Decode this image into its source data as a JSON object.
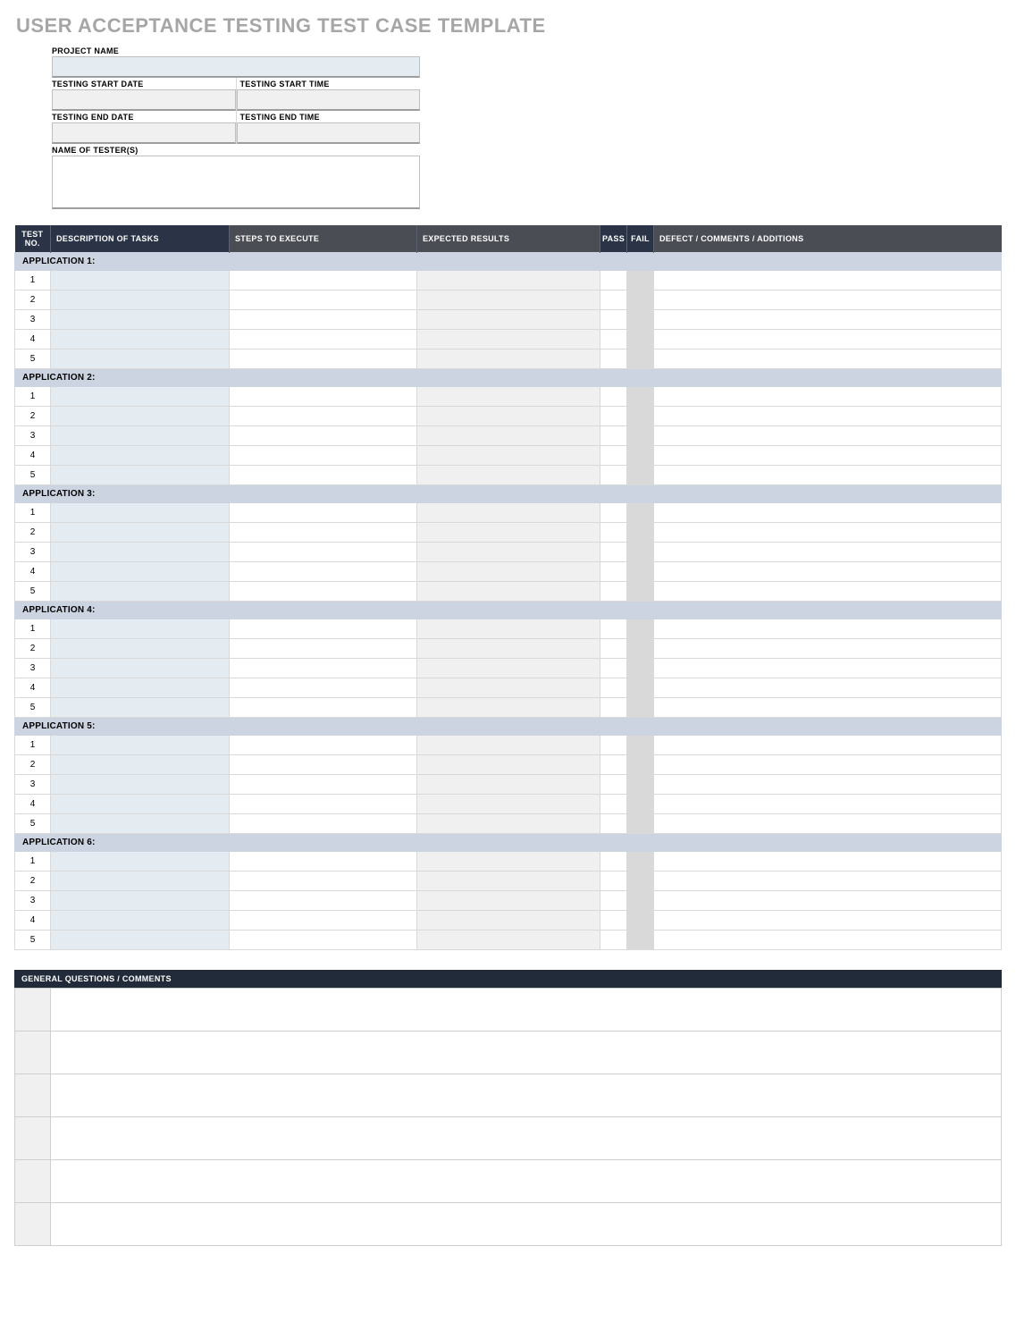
{
  "title": "USER ACCEPTANCE TESTING TEST CASE TEMPLATE",
  "meta": {
    "project_name_label": "PROJECT NAME",
    "project_name_value": "",
    "start_date_label": "TESTING START DATE",
    "start_date_value": "",
    "start_time_label": "TESTING START TIME",
    "start_time_value": "",
    "end_date_label": "TESTING END DATE",
    "end_date_value": "",
    "end_time_label": "TESTING END TIME",
    "end_time_value": "",
    "testers_label": "NAME OF TESTER(S)",
    "testers_value": ""
  },
  "columns": {
    "test_no": "TEST NO.",
    "description": "DESCRIPTION OF TASKS",
    "steps": "STEPS TO EXECUTE",
    "expected": "EXPECTED RESULTS",
    "pass": "PASS",
    "fail": "FAIL",
    "defect": "DEFECT / COMMENTS / ADDITIONS"
  },
  "apps": [
    {
      "heading": "APPLICATION 1:",
      "rows": [
        {
          "no": "1",
          "desc": "",
          "steps": "",
          "expected": "",
          "pass": "",
          "fail": "",
          "defect": ""
        },
        {
          "no": "2",
          "desc": "",
          "steps": "",
          "expected": "",
          "pass": "",
          "fail": "",
          "defect": ""
        },
        {
          "no": "3",
          "desc": "",
          "steps": "",
          "expected": "",
          "pass": "",
          "fail": "",
          "defect": ""
        },
        {
          "no": "4",
          "desc": "",
          "steps": "",
          "expected": "",
          "pass": "",
          "fail": "",
          "defect": ""
        },
        {
          "no": "5",
          "desc": "",
          "steps": "",
          "expected": "",
          "pass": "",
          "fail": "",
          "defect": ""
        }
      ]
    },
    {
      "heading": "APPLICATION 2:",
      "rows": [
        {
          "no": "1",
          "desc": "",
          "steps": "",
          "expected": "",
          "pass": "",
          "fail": "",
          "defect": ""
        },
        {
          "no": "2",
          "desc": "",
          "steps": "",
          "expected": "",
          "pass": "",
          "fail": "",
          "defect": ""
        },
        {
          "no": "3",
          "desc": "",
          "steps": "",
          "expected": "",
          "pass": "",
          "fail": "",
          "defect": ""
        },
        {
          "no": "4",
          "desc": "",
          "steps": "",
          "expected": "",
          "pass": "",
          "fail": "",
          "defect": ""
        },
        {
          "no": "5",
          "desc": "",
          "steps": "",
          "expected": "",
          "pass": "",
          "fail": "",
          "defect": ""
        }
      ]
    },
    {
      "heading": "APPLICATION 3:",
      "rows": [
        {
          "no": "1",
          "desc": "",
          "steps": "",
          "expected": "",
          "pass": "",
          "fail": "",
          "defect": ""
        },
        {
          "no": "2",
          "desc": "",
          "steps": "",
          "expected": "",
          "pass": "",
          "fail": "",
          "defect": ""
        },
        {
          "no": "3",
          "desc": "",
          "steps": "",
          "expected": "",
          "pass": "",
          "fail": "",
          "defect": ""
        },
        {
          "no": "4",
          "desc": "",
          "steps": "",
          "expected": "",
          "pass": "",
          "fail": "",
          "defect": ""
        },
        {
          "no": "5",
          "desc": "",
          "steps": "",
          "expected": "",
          "pass": "",
          "fail": "",
          "defect": ""
        }
      ]
    },
    {
      "heading": "APPLICATION 4:",
      "rows": [
        {
          "no": "1",
          "desc": "",
          "steps": "",
          "expected": "",
          "pass": "",
          "fail": "",
          "defect": ""
        },
        {
          "no": "2",
          "desc": "",
          "steps": "",
          "expected": "",
          "pass": "",
          "fail": "",
          "defect": ""
        },
        {
          "no": "3",
          "desc": "",
          "steps": "",
          "expected": "",
          "pass": "",
          "fail": "",
          "defect": ""
        },
        {
          "no": "4",
          "desc": "",
          "steps": "",
          "expected": "",
          "pass": "",
          "fail": "",
          "defect": ""
        },
        {
          "no": "5",
          "desc": "",
          "steps": "",
          "expected": "",
          "pass": "",
          "fail": "",
          "defect": ""
        }
      ]
    },
    {
      "heading": "APPLICATION 5:",
      "rows": [
        {
          "no": "1",
          "desc": "",
          "steps": "",
          "expected": "",
          "pass": "",
          "fail": "",
          "defect": ""
        },
        {
          "no": "2",
          "desc": "",
          "steps": "",
          "expected": "",
          "pass": "",
          "fail": "",
          "defect": ""
        },
        {
          "no": "3",
          "desc": "",
          "steps": "",
          "expected": "",
          "pass": "",
          "fail": "",
          "defect": ""
        },
        {
          "no": "4",
          "desc": "",
          "steps": "",
          "expected": "",
          "pass": "",
          "fail": "",
          "defect": ""
        },
        {
          "no": "5",
          "desc": "",
          "steps": "",
          "expected": "",
          "pass": "",
          "fail": "",
          "defect": ""
        }
      ]
    },
    {
      "heading": "APPLICATION 6:",
      "rows": [
        {
          "no": "1",
          "desc": "",
          "steps": "",
          "expected": "",
          "pass": "",
          "fail": "",
          "defect": ""
        },
        {
          "no": "2",
          "desc": "",
          "steps": "",
          "expected": "",
          "pass": "",
          "fail": "",
          "defect": ""
        },
        {
          "no": "3",
          "desc": "",
          "steps": "",
          "expected": "",
          "pass": "",
          "fail": "",
          "defect": ""
        },
        {
          "no": "4",
          "desc": "",
          "steps": "",
          "expected": "",
          "pass": "",
          "fail": "",
          "defect": ""
        },
        {
          "no": "5",
          "desc": "",
          "steps": "",
          "expected": "",
          "pass": "",
          "fail": "",
          "defect": ""
        }
      ]
    }
  ],
  "general": {
    "heading": "GENERAL QUESTIONS / COMMENTS",
    "rows": [
      {
        "label": "",
        "body": ""
      },
      {
        "label": "",
        "body": ""
      },
      {
        "label": "",
        "body": ""
      },
      {
        "label": "",
        "body": ""
      },
      {
        "label": "",
        "body": ""
      },
      {
        "label": "",
        "body": ""
      }
    ]
  }
}
